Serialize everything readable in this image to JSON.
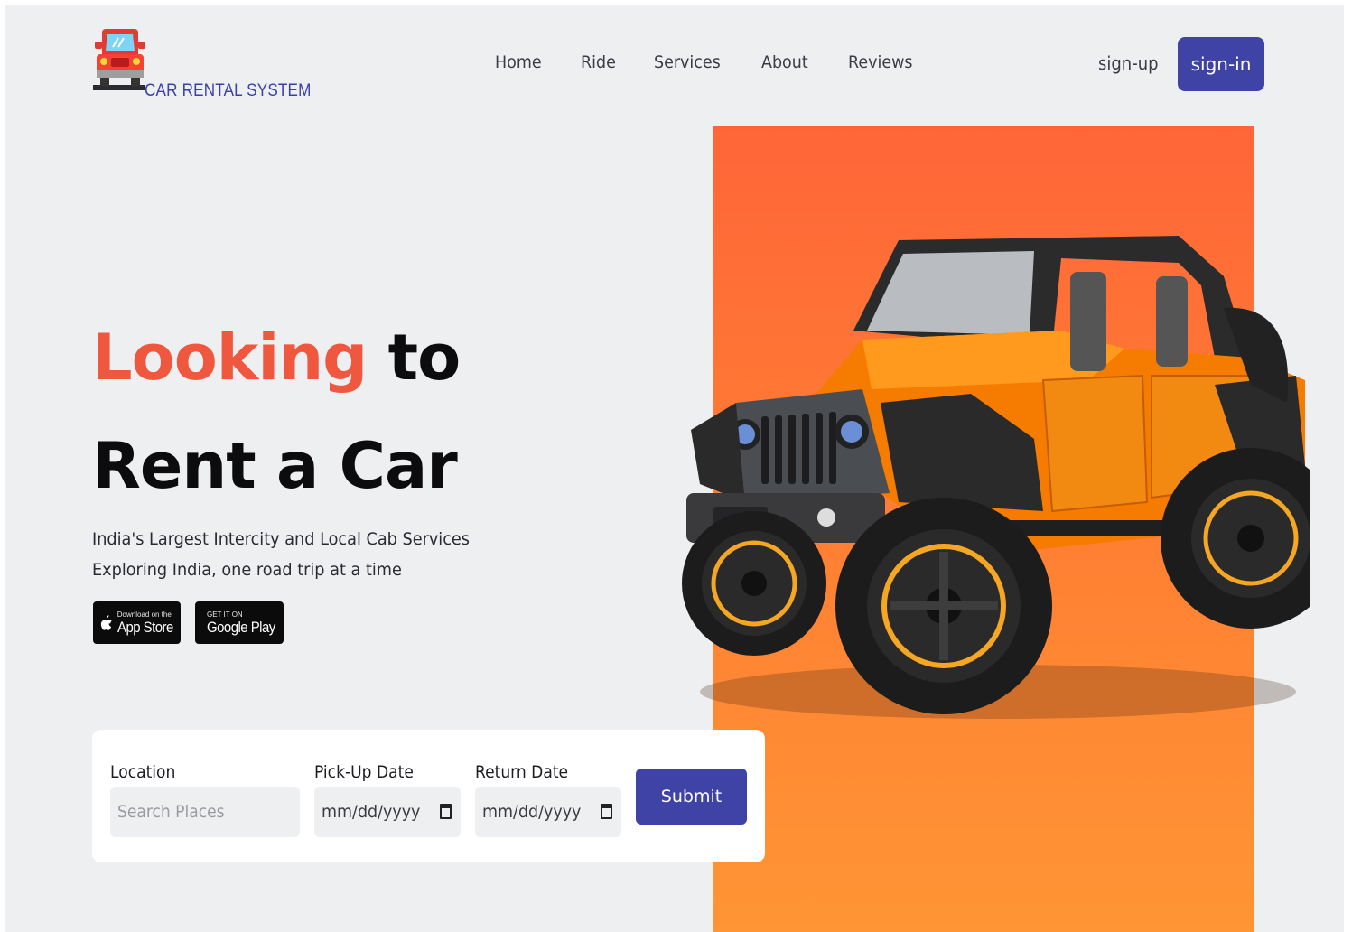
{
  "brand": {
    "name": "CAR RENTAL SYSTEM",
    "logo_icon": "red-car-front-icon"
  },
  "nav": {
    "items": [
      {
        "label": "Home"
      },
      {
        "label": "Ride"
      },
      {
        "label": "Services"
      },
      {
        "label": "About"
      },
      {
        "label": "Reviews"
      }
    ],
    "signup_label": "sign-up",
    "signin_label": "sign-in"
  },
  "hero": {
    "headline_accent": "Looking",
    "headline_rest_line1": "to",
    "headline_line2": "Rent a Car",
    "subtitle_line1": "India's Largest Intercity and Local Cab Services",
    "subtitle_line2": "Exploring India, one road trip at a time",
    "app_store": {
      "small": "Download on the",
      "big": "App Store",
      "icon": "apple-icon"
    },
    "google_play": {
      "small": "GET IT ON",
      "big": "Google Play",
      "icon": "google-play-icon"
    },
    "image": "orange-jeep-image"
  },
  "search_form": {
    "location_label": "Location",
    "location_placeholder": "Search Places",
    "pickup_label": "Pick-Up Date",
    "pickup_value": "mm/dd/yyyy",
    "return_label": "Return Date",
    "return_value": "mm/dd/yyyy",
    "submit_label": "Submit"
  },
  "colors": {
    "background": "#eeeff1",
    "primary": "#3f43a6",
    "accent": "#f0573f",
    "hero_orange_top": "#ff6538",
    "hero_orange_bottom": "#ff9534"
  }
}
